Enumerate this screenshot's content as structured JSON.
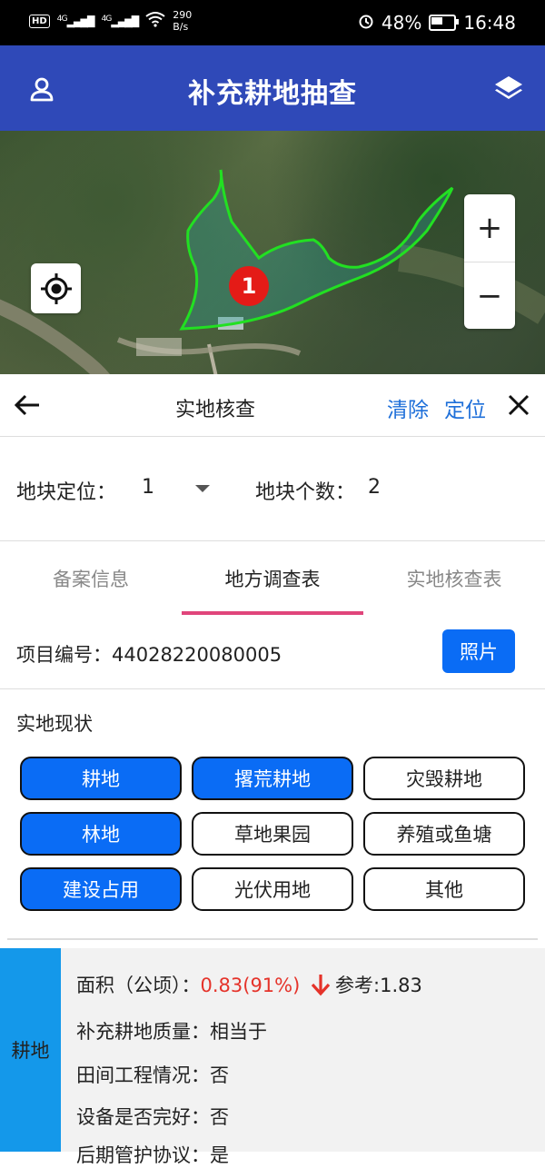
{
  "status_bar": {
    "hd": "HD",
    "sig1": "4G",
    "sig2": "4G",
    "speed_value": "290",
    "speed_unit": "B/s",
    "battery": "48%",
    "time": "16:48"
  },
  "header": {
    "title": "补充耕地抽查"
  },
  "map": {
    "marker_label": "1",
    "zoom_in": "+",
    "zoom_out": "−"
  },
  "panel": {
    "title": "实地核查",
    "clear": "清除",
    "locate": "定位"
  },
  "parcel": {
    "label": "地块定位：",
    "value": "1",
    "count_label": "地块个数：",
    "count": "2"
  },
  "tabs": [
    {
      "label": "备案信息",
      "active": false
    },
    {
      "label": "地方调查表",
      "active": true
    },
    {
      "label": "实地核查表",
      "active": false
    }
  ],
  "project": {
    "label": "项目编号：",
    "number": "44028220080005",
    "photo_button": "照片"
  },
  "status": {
    "title": "实地现状",
    "options": [
      {
        "label": "耕地",
        "selected": true
      },
      {
        "label": "撂荒耕地",
        "selected": true
      },
      {
        "label": "灾毁耕地",
        "selected": false
      },
      {
        "label": "林地",
        "selected": true
      },
      {
        "label": "草地果园",
        "selected": false
      },
      {
        "label": "养殖或鱼塘",
        "selected": false
      },
      {
        "label": "建设占用",
        "selected": true
      },
      {
        "label": "光伏用地",
        "selected": false
      },
      {
        "label": "其他",
        "selected": false
      }
    ]
  },
  "detail": {
    "category": "耕地",
    "area_label": "面积（公顷）：",
    "area_value": "0.83(91%)",
    "ref": "参考:1.83",
    "quality_label": "补充耕地质量：",
    "quality_value": "相当于",
    "engineering_label": "田间工程情况：",
    "engineering_value": "否",
    "equipment_label": "设备是否完好：",
    "equipment_value": "否",
    "partial_line": "后期管护协议：是"
  },
  "colors": {
    "header": "#2f49b8",
    "accent_blue": "#0a6cf5",
    "link_blue": "#1e6fd9",
    "tab_indicator": "#e0457b",
    "marker_red": "#e41b17",
    "side_blue": "#1498ea",
    "polygon_green": "#22e022"
  }
}
